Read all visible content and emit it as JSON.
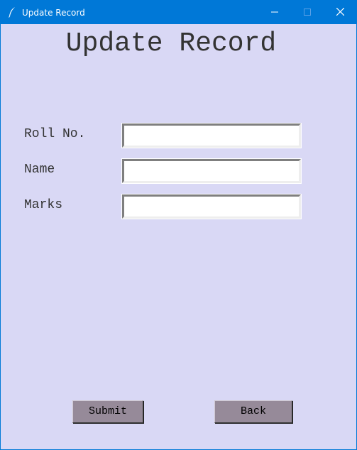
{
  "window": {
    "title": "Update Record",
    "icon": "feather-icon",
    "controls": [
      "minimize-icon",
      "maximize-icon",
      "close-icon"
    ]
  },
  "form": {
    "heading": "Update Record",
    "fields": [
      {
        "label": "Roll No.",
        "value": ""
      },
      {
        "label": "Name",
        "value": ""
      },
      {
        "label": "Marks",
        "value": ""
      }
    ],
    "buttons": {
      "submit": "Submit",
      "back": "Back"
    }
  },
  "colors": {
    "titlebar": "#0078d7",
    "background": "#d9d8f5",
    "button": "#968a99",
    "text": "#333333"
  }
}
